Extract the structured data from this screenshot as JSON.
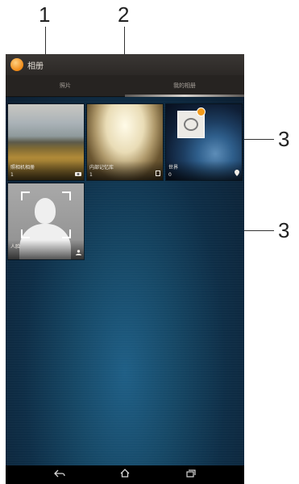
{
  "callouts": [
    "1",
    "2",
    "3",
    "3"
  ],
  "app": {
    "title": "相册",
    "logo_icon": "album-orange-icon"
  },
  "tabs": [
    {
      "label": "照片",
      "active": false
    },
    {
      "label": "我的相册",
      "active": true
    }
  ],
  "albums": [
    {
      "label": "照相机相册",
      "count": "1",
      "type_icon": "camera-icon"
    },
    {
      "label": "内部记忆库",
      "count": "1",
      "type_icon": "storage-icon"
    },
    {
      "label": "世界",
      "count": "0",
      "type_icon": "location-pin-icon"
    },
    {
      "label": "人脸",
      "count": "",
      "type_icon": "person-icon"
    }
  ],
  "navbar": {
    "back_icon": "back-icon",
    "home_icon": "home-icon",
    "recent_icon": "recent-apps-icon"
  },
  "colors": {
    "accent": "#f29b1c",
    "background": "#0e2e47"
  }
}
